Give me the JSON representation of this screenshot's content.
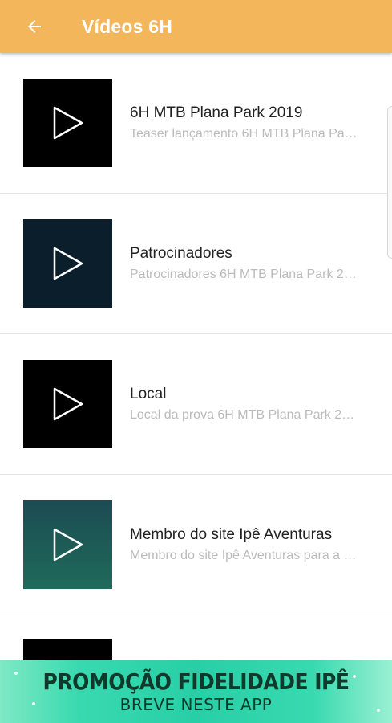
{
  "appbar": {
    "title": "Vídeos 6H",
    "back_icon": "arrow-left-icon",
    "color": "#f3b65a"
  },
  "videos": [
    {
      "title": "6H MTB Plana Park 2019",
      "subtitle": "Teaser lançamento 6H MTB Plana Park 2019",
      "thumb_color": "#000000",
      "icon": "play-icon"
    },
    {
      "title": "Patrocinadores",
      "subtitle": "Patrocinadores 6H MTB Plana Park 2019",
      "thumb_color": "#0b1e2b",
      "icon": "play-icon"
    },
    {
      "title": "Local",
      "subtitle": "Local da prova 6H MTB Plana Park 2019",
      "thumb_color": "#000000",
      "icon": "play-icon"
    },
    {
      "title": "Membro do site Ipê Aventuras",
      "subtitle": "Membro do site Ipê Aventuras para a prova",
      "thumb_color": "#1f5a5a",
      "icon": "play-icon"
    }
  ],
  "banner": {
    "headline": "PROMOÇÃO FIDELIDADE IPÊ",
    "subline": "BREVE NESTE APP",
    "color": "#28cfa6"
  }
}
